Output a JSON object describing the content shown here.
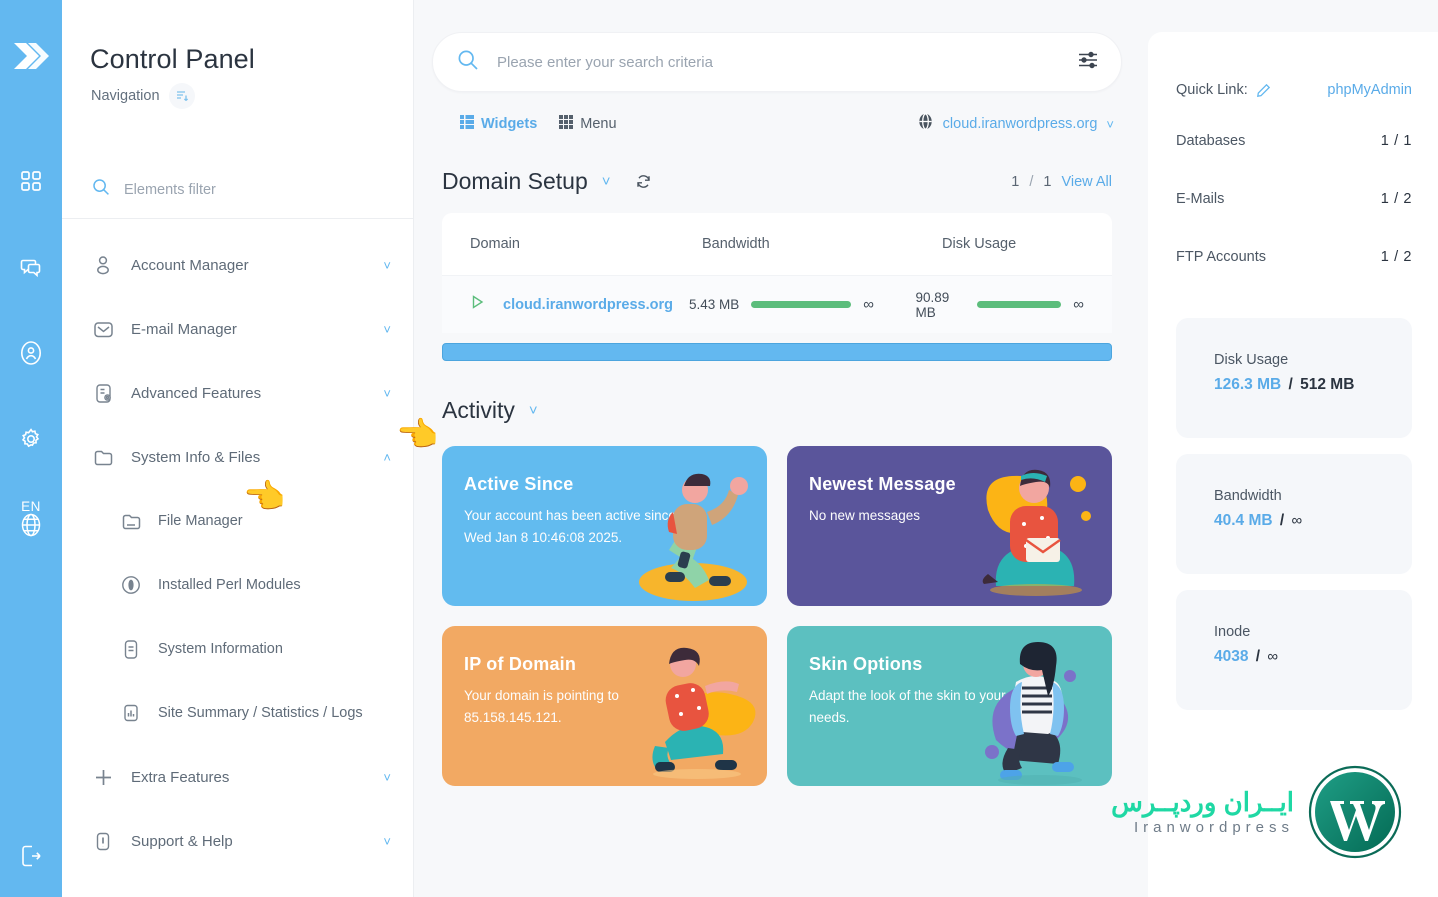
{
  "rail": {
    "logo_icon": "double-chevron-right-icon",
    "items": [
      {
        "name": "dashboard-grid-icon"
      },
      {
        "name": "chat-icon"
      },
      {
        "name": "user-circle-icon"
      },
      {
        "name": "gear-icon"
      },
      {
        "name": "globe-icon"
      }
    ],
    "language": "EN",
    "logout_icon": "logout-icon"
  },
  "sidebar": {
    "title": "Control Panel",
    "subtitle": "Navigation",
    "collapse_icon": "collapse-list-icon",
    "filter": {
      "placeholder": "Elements filter",
      "value": "",
      "icon": "search-icon"
    },
    "items": [
      {
        "label": "Account Manager",
        "icon": "user-icon",
        "chevron": "˅",
        "expanded": false
      },
      {
        "label": "E-mail Manager",
        "icon": "envelope-icon",
        "chevron": "˅",
        "expanded": false
      },
      {
        "label": "Advanced Features",
        "icon": "document-gear-icon",
        "chevron": "˅",
        "expanded": false
      },
      {
        "label": "System Info & Files",
        "icon": "folder-icon",
        "chevron": "˄",
        "expanded": true
      }
    ],
    "sub_items": [
      {
        "label": "File Manager",
        "icon": "folder-open-icon"
      },
      {
        "label": "Installed Perl Modules",
        "icon": "perl-icon"
      },
      {
        "label": "System Information",
        "icon": "info-document-icon"
      },
      {
        "label": "Site Summary / Statistics / Logs",
        "icon": "chart-document-icon"
      }
    ],
    "items_after": [
      {
        "label": "Extra Features",
        "icon": "plus-icon",
        "chevron": "˅"
      },
      {
        "label": "Support & Help",
        "icon": "alert-icon",
        "chevron": "˅"
      }
    ]
  },
  "search": {
    "placeholder": "Please enter your search criteria",
    "value": "",
    "icon": "search-icon",
    "filter_icon": "sliders-icon"
  },
  "toolbar": {
    "widgets_label": "Widgets",
    "widgets_icon": "widgets-grid-icon",
    "menu_label": "Menu",
    "menu_icon": "menu-grid-icon",
    "domain_label": "cloud.iranwordpress.org",
    "domain_icon": "globe-icon",
    "domain_chevron": "˅"
  },
  "domain_setup": {
    "title": "Domain Setup",
    "chevron": "˅",
    "refresh_icon": "refresh-icon",
    "page_current": "1",
    "page_sep": "/",
    "page_total": "1",
    "view_all": "View All",
    "columns": [
      "Domain",
      "Bandwidth",
      "Disk Usage"
    ],
    "rows": [
      {
        "expand_icon": "triangle-right-icon",
        "domain": "cloud.iranwordpress.org",
        "bandwidth_value": "5.43 MB",
        "bandwidth_limit": "∞",
        "disk_value": "90.89 MB",
        "disk_limit": "∞"
      }
    ]
  },
  "activity": {
    "title": "Activity",
    "chevron": "˅",
    "cards": [
      {
        "title": "Active Since",
        "text": "Your account has been active since Wed Jan 8 10:46:08 2025.",
        "color": "#62bbef",
        "art": "person-waving"
      },
      {
        "title": "Newest Message",
        "text": "No new messages",
        "color": "#5a559b",
        "art": "person-with-envelope"
      },
      {
        "title": "IP of Domain",
        "text": "Your domain is pointing to 85.158.145.121.",
        "color": "#f2a963",
        "art": "person-running"
      },
      {
        "title": "Skin Options",
        "text": "Adapt the look of the skin to your own needs.",
        "color": "#5cc0c0",
        "art": "person-standing"
      }
    ]
  },
  "right_panel": {
    "quick_link_label": "Quick Link:",
    "quick_link_edit_icon": "pencil-icon",
    "quick_link_value": "phpMyAdmin",
    "stats": [
      {
        "name": "Databases",
        "value": "1 / 1"
      },
      {
        "name": "E-Mails",
        "value": "1 / 2"
      },
      {
        "name": "FTP Accounts",
        "value": "1 / 2"
      }
    ],
    "meters": [
      {
        "label": "Disk Usage",
        "used": "126.3 MB",
        "sep": "/",
        "total": "512 MB",
        "total_is_infinity": false
      },
      {
        "label": "Bandwidth",
        "used": "40.4 MB",
        "sep": "/",
        "total": "∞",
        "total_is_infinity": true
      },
      {
        "label": "Inode",
        "used": "4038",
        "sep": "/",
        "total": "∞",
        "total_is_infinity": true
      }
    ],
    "watermark": {
      "fa": "ایــران وردپــرس",
      "en": "Iranwordpress",
      "logo_icon": "wordpress-icon"
    }
  },
  "colors": {
    "accent": "#5aabe8",
    "rail": "#63b8f0",
    "green": "#5cbd7c",
    "wp_green": "#0e8a6e"
  }
}
